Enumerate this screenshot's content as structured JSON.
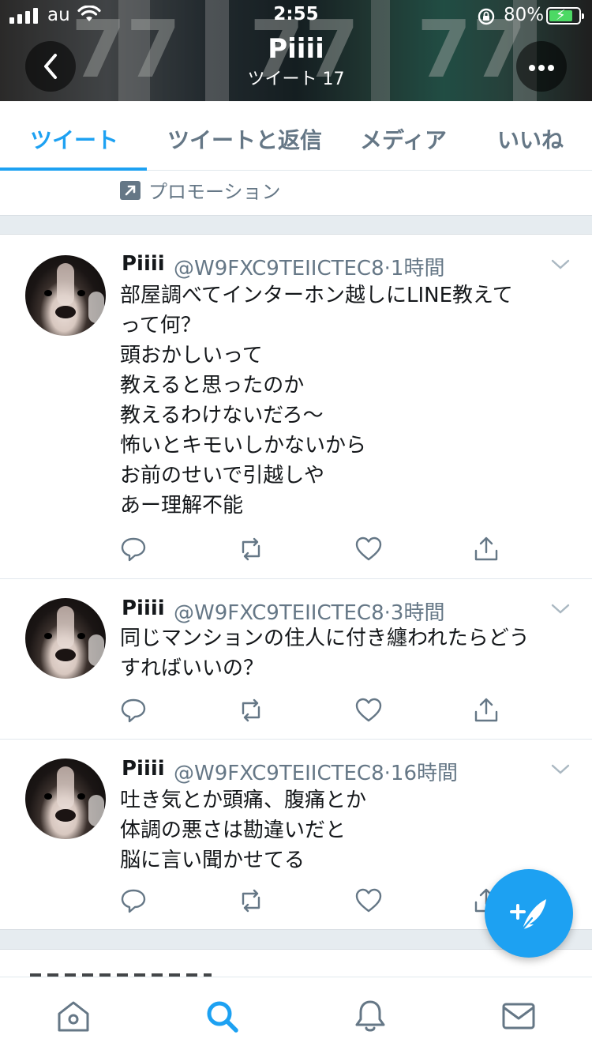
{
  "status_bar": {
    "carrier": "au",
    "time": "2:55",
    "battery_percent": "80%",
    "battery_level": 0.8,
    "charging": true
  },
  "header": {
    "background_numbers": [
      "77",
      "77",
      "77"
    ],
    "title": "Piiii",
    "subtitle": "ツイート 17",
    "back_icon": "chevron-left-icon",
    "more_icon": "more-horizontal-icon"
  },
  "tabs": [
    {
      "label": "ツイート",
      "active": true
    },
    {
      "label": "ツイートと返信",
      "active": false
    },
    {
      "label": "メディア",
      "active": false
    },
    {
      "label": "いいね",
      "active": false
    }
  ],
  "promo": {
    "label": "プロモーション",
    "icon": "promoted-arrow-icon"
  },
  "tweets": [
    {
      "name": "Piiii",
      "handle": "@W9FXC9TEIICTEC8",
      "time": "1時間",
      "text": "部屋調べてインターホン越しにLINE教えて\nって何？\n頭おかしいって\n教えると思ったのか\n教えるわけないだろ〜\n怖いとキモいしかないから\nお前のせいで引越しや\nあー理解不能"
    },
    {
      "name": "Piiii",
      "handle": "@W9FXC9TEIICTEC8",
      "time": "3時間",
      "text": "同じマンションの住人に付き纏われたらどう\nすればいいの？"
    },
    {
      "name": "Piiii",
      "handle": "@W9FXC9TEIICTEC8",
      "time": "16時間",
      "text": "吐き気とか頭痛、腹痛とか\n体調の悪さは勘違いだと\n脳に言い聞かせてる"
    }
  ],
  "actions": [
    "reply-icon",
    "retweet-icon",
    "like-icon",
    "share-icon"
  ],
  "fab": {
    "icon": "compose-tweet-icon"
  },
  "bottom_nav": [
    {
      "name": "home",
      "icon": "home-icon",
      "active": false
    },
    {
      "name": "search",
      "icon": "search-icon",
      "active": true
    },
    {
      "name": "notifications",
      "icon": "bell-icon",
      "active": false
    },
    {
      "name": "messages",
      "icon": "envelope-icon",
      "active": false
    }
  ],
  "colors": {
    "accent": "#1da1f2",
    "muted": "#657786",
    "text": "#14171a",
    "divider": "#e6ecf0"
  }
}
